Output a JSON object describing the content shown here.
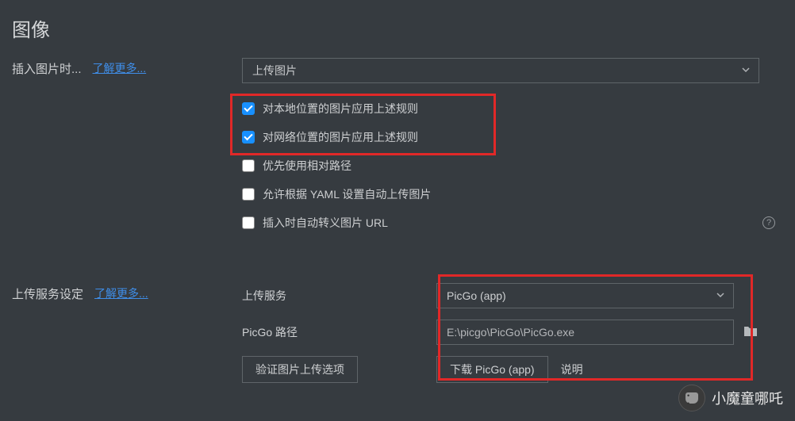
{
  "title": "图像",
  "insertSection": {
    "label": "插入图片时...",
    "learnMore": "了解更多...",
    "select": "上传图片",
    "checkboxes": [
      {
        "label": "对本地位置的图片应用上述规则",
        "checked": true
      },
      {
        "label": "对网络位置的图片应用上述规则",
        "checked": true
      },
      {
        "label": "优先使用相对路径",
        "checked": false
      },
      {
        "label": "允许根据 YAML 设置自动上传图片",
        "checked": false
      },
      {
        "label": "插入时自动转义图片 URL",
        "checked": false,
        "hasHelp": true
      }
    ]
  },
  "uploadSection": {
    "label": "上传服务设定",
    "learnMore": "了解更多...",
    "serviceLabel": "上传服务",
    "serviceValue": "PicGo (app)",
    "pathLabel": "PicGo 路径",
    "pathValue": "E:\\picgo\\PicGo\\PicGo.exe",
    "validateBtn": "验证图片上传选项",
    "downloadBtn": "下载 PicGo (app)",
    "descText": "说明"
  },
  "watermark": "小魔童哪吒"
}
